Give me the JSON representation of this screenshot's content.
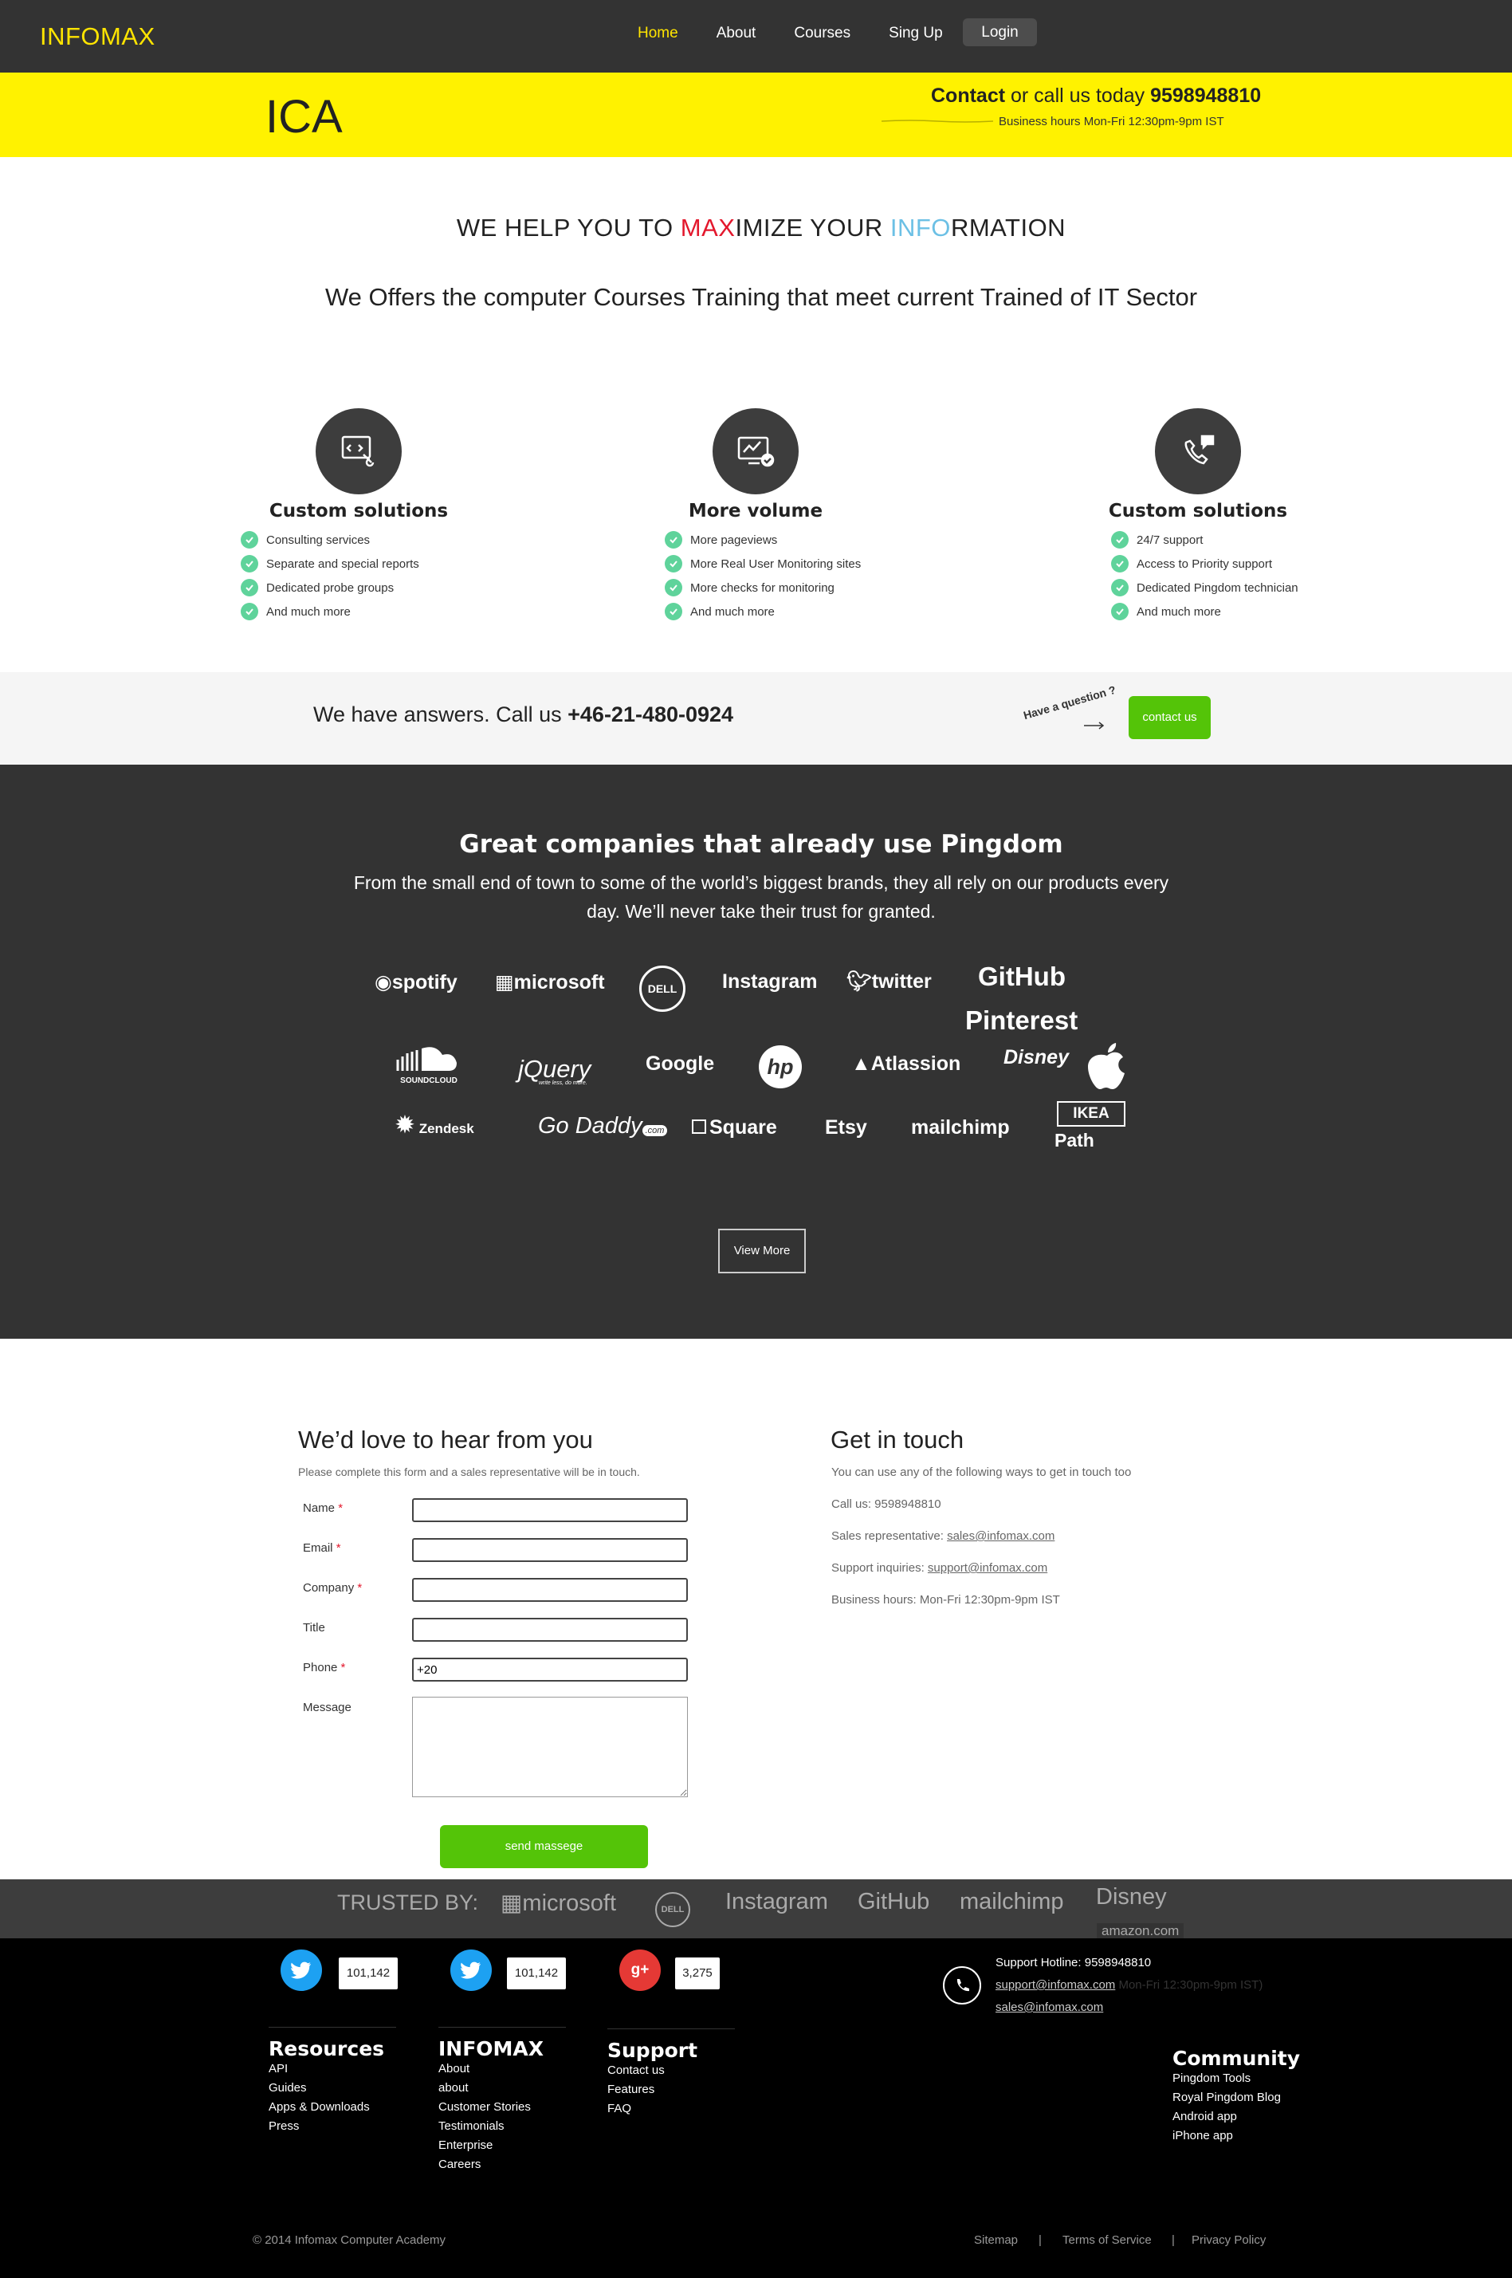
{
  "nav": {
    "brand": "INFOMAX",
    "links": [
      "Home",
      "About",
      "Courses",
      "Sing Up"
    ],
    "login": "Login"
  },
  "banner": {
    "logo": "ICA",
    "contact_bold": "Contact",
    "contact_mid": " or call us today ",
    "phone": "9598948810",
    "hours": "Business hours Mon-Fri 12:30pm-9pm IST"
  },
  "hero": {
    "title_a": "WE HELP YOU TO ",
    "title_red": "MAX",
    "title_b": "IMIZE YOUR ",
    "title_blue": "INFO",
    "title_c": "RMATION",
    "subtitle": "We Offers the computer Courses Training that meet current Trained of IT Sector"
  },
  "features": [
    {
      "icon": "code-monitor-icon",
      "title": "Custom solutions",
      "items": [
        "Consulting services",
        "Separate and special reports",
        "Dedicated probe groups",
        "And much more"
      ]
    },
    {
      "icon": "monitoring-chart-icon",
      "title": "More volume",
      "items": [
        "More pageviews",
        "More Real User Monitoring sites",
        "More checks for monitoring",
        "And much more"
      ]
    },
    {
      "icon": "phone-chat-icon",
      "title": "Custom solutions",
      "items": [
        "24/7 support",
        "Access to Priority support",
        "Dedicated Pingdom technician",
        "And much more"
      ]
    }
  ],
  "answers": {
    "text": "We have answers. Call us ",
    "phone": "+46-21-480-0924",
    "question": "Have a question ?",
    "button": "contact us"
  },
  "companies": {
    "title": "Great companies that already use Pingdom",
    "description": "From the small end of town to some of the world’s biggest brands, they all rely on our products every day. We’ll never take their trust for granted.",
    "logos": [
      "spotify",
      "microsoft",
      "DELL",
      "Instagram",
      "twitter",
      "GitHub",
      "Pinterest",
      "SOUNDCLOUD",
      "jQuery",
      "Google",
      "hp",
      "Atlassion",
      "Disney",
      "Zendesk",
      "Go Daddy",
      ".com",
      "Square",
      "Etsy",
      "mailchimp",
      "IKEA",
      "Path",
      "write less, do more."
    ],
    "view_more": "View More"
  },
  "form": {
    "title": "We’d love to hear from you",
    "description": "Please complete this form and a sales representative will be in touch.",
    "fields": [
      {
        "label": "Name",
        "required": "*",
        "value": ""
      },
      {
        "label": "Email",
        "required": "*",
        "value": ""
      },
      {
        "label": "Company",
        "required": "*",
        "value": ""
      },
      {
        "label": "Title",
        "required": "",
        "value": ""
      },
      {
        "label": "Phone",
        "required": "*",
        "value": "+20"
      },
      {
        "label": "Message",
        "required": "",
        "value": ""
      }
    ],
    "submit": "send massege"
  },
  "get_in_touch": {
    "title": "Get in touch",
    "description": "You can use any of the following ways to get in touch too",
    "call": "Call us: 9598948810",
    "sales_label": "Sales representative: ",
    "sales_email": "sales@infomax.com",
    "support_label": "Support inquiries: ",
    "support_email": "support@infomax.com",
    "hours": "Business hours: Mon-Fri 12:30pm-9pm IST"
  },
  "trusted": {
    "label": "TRUSTED BY:",
    "logos": [
      "microsoft",
      "DELL",
      "Instagram",
      "GitHub",
      "mailchimp",
      "Disney",
      "amazon.com"
    ]
  },
  "footer": {
    "social": [
      {
        "icon": "twitter-icon",
        "count": "101,142"
      },
      {
        "icon": "twitter-icon",
        "count": "101,142"
      },
      {
        "icon": "google-plus-icon",
        "count": "3,275"
      }
    ],
    "support_hotline": "Support Hotline: 9598948810",
    "support_email": "support@infomax.com",
    "support_hours": " Mon-Fri 12:30pm-9pm IST)",
    "sales_email": "sales@infomax.com",
    "columns": [
      {
        "title": "Resources",
        "items": [
          "API",
          "Guides",
          "Apps & Downloads",
          "Press"
        ]
      },
      {
        "title": "INFOMAX",
        "items": [
          "About",
          "about",
          "Customer Stories",
          "Testimonials",
          "Enterprise",
          "Careers"
        ]
      },
      {
        "title": "Support",
        "items": [
          "Contact us",
          "Features",
          "FAQ"
        ]
      },
      {
        "title": "Community",
        "items": [
          "Pingdom Tools",
          "Royal Pingdom Blog",
          "Android app",
          "iPhone app"
        ]
      }
    ],
    "copyright": "© 2014 Infomax Computer Academy",
    "legal": [
      "Sitemap",
      "Terms of Service",
      "Privacy Policy"
    ],
    "separator": "|"
  },
  "colors": {
    "dark": "#333333",
    "yellow": "#fff200",
    "brand_yellow": "#ffe400",
    "green": "#54c408",
    "check": "#5fd39b",
    "red": "#e3182d",
    "blue": "#6cc0e5"
  }
}
